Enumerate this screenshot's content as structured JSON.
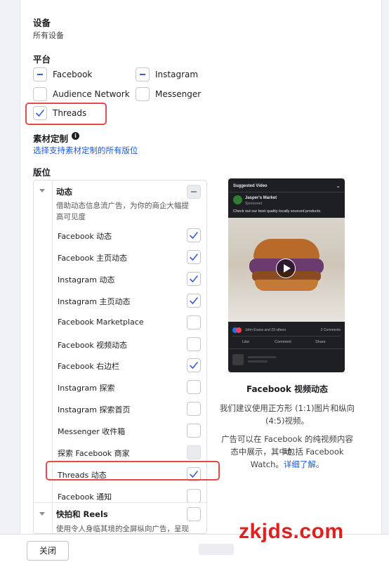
{
  "device": {
    "title": "设备",
    "value": "所有设备"
  },
  "platform": {
    "title": "平台",
    "items": [
      {
        "label": "Facebook",
        "state": "partial"
      },
      {
        "label": "Instagram",
        "state": "partial"
      },
      {
        "label": "Audience Network",
        "state": "unchecked"
      },
      {
        "label": "Messenger",
        "state": "unchecked"
      },
      {
        "label": "Threads",
        "state": "checked"
      }
    ]
  },
  "asset_customization": {
    "title": "素材定制",
    "info_icon": "info-icon",
    "link": "选择支持素材定制的所有版位"
  },
  "placements": {
    "title": "版位",
    "feeds": {
      "title": "动态",
      "state": "partial-disabled",
      "description_line1": "借助动态信息流广告，为你的商企大幅提",
      "description_line2": "高可见度",
      "items": [
        {
          "label": "Facebook 动态",
          "state": "checked"
        },
        {
          "label": "Facebook 主页动态",
          "state": "checked"
        },
        {
          "label": "Instagram 动态",
          "state": "checked"
        },
        {
          "label": "Instagram 主页动态",
          "state": "checked"
        },
        {
          "label": "Facebook Marketplace",
          "state": "unchecked"
        },
        {
          "label": "Facebook 视频动态",
          "state": "unchecked"
        },
        {
          "label": "Facebook 右边栏",
          "state": "checked"
        },
        {
          "label": "Instagram 探索",
          "state": "unchecked"
        },
        {
          "label": "Instagram 探索首页",
          "state": "unchecked"
        },
        {
          "label": "Messenger 收件箱",
          "state": "unchecked"
        },
        {
          "label": "探索 Facebook 商家",
          "state": "disabled"
        },
        {
          "label": "Threads 动态",
          "state": "checked"
        },
        {
          "label": "Facebook 通知",
          "state": "unchecked"
        }
      ]
    },
    "stories": {
      "title": "快拍和 Reels",
      "state": "unchecked",
      "description": "使用令人身临其境的全屏纵向广告，呈现"
    }
  },
  "preview": {
    "phone": {
      "header": "Suggested Video",
      "page_name": "Jasper's Market",
      "sponsored": "Sponsored",
      "caption": "Check out our best quality locally sourced products.",
      "reactions": "John Evans and 23 others",
      "comments_count": "2 Comments",
      "actions": [
        "Like",
        "Comment",
        "Share"
      ]
    },
    "title": "Facebook 视频动态",
    "desc1_line1": "我们建议使用正方形 (1:1)图片和纵向",
    "desc1_line2": "(4:5)视频。",
    "desc2_line1": "广告可以在 Facebook 的纯视频内容动",
    "desc2_line2": "态中展示，其中包括 Facebook",
    "desc2_line3a": "Watch。",
    "desc2_link": "详细了解。"
  },
  "footer": {
    "close_label": "关闭"
  },
  "watermark": "zkjds.com",
  "colors": {
    "accent": "#1e5bd6",
    "highlight": "#e24b4b",
    "check": "#3b5bdb"
  }
}
